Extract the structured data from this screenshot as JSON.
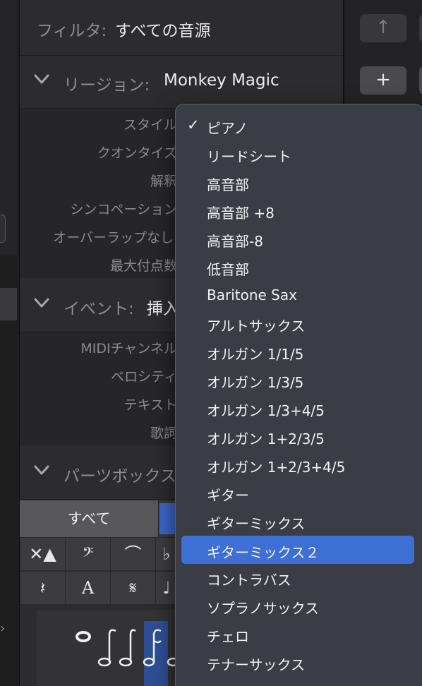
{
  "filter": {
    "label": "フィルタ:",
    "value": "すべての音源"
  },
  "region": {
    "label": "リージョン:",
    "value": "Monkey Magic"
  },
  "region_params": [
    "スタイル",
    "クオンタイズ",
    "解釈",
    "シンコペーション",
    "オーバーラップなし",
    "最大付点数"
  ],
  "event": {
    "label": "イベント:",
    "value": "挿入"
  },
  "event_params": [
    "MIDIチャンネル",
    "ベロシティ",
    "テキスト",
    "歌詞"
  ],
  "parts": {
    "label": "パーツボックス",
    "tab_all": "すべて"
  },
  "symbols": [
    "✕▲",
    "𝄢",
    "⌒",
    "♭",
    "𝄽",
    "A",
    "𝄋",
    "♩"
  ],
  "toolbar": {
    "up_icon": "↑",
    "add_icon": "+"
  },
  "menu": {
    "selected": "ピアノ",
    "highlighted": "ギターミックス２",
    "items": [
      "ピアノ",
      "リードシート",
      "高音部",
      "高音部 +8",
      "高音部-8",
      "低音部",
      "Baritone Sax",
      "アルトサックス",
      "オルガン 1/1/5",
      "オルガン 1/3/5",
      "オルガン 1/3+4/5",
      "オルガン 1+2/3/5",
      "オルガン 1+2/3+4/5",
      "ギター",
      "ギターミックス",
      "ギターミックス２",
      "コントラバス",
      "ソプラノサックス",
      "チェロ",
      "テナーサックス"
    ]
  }
}
